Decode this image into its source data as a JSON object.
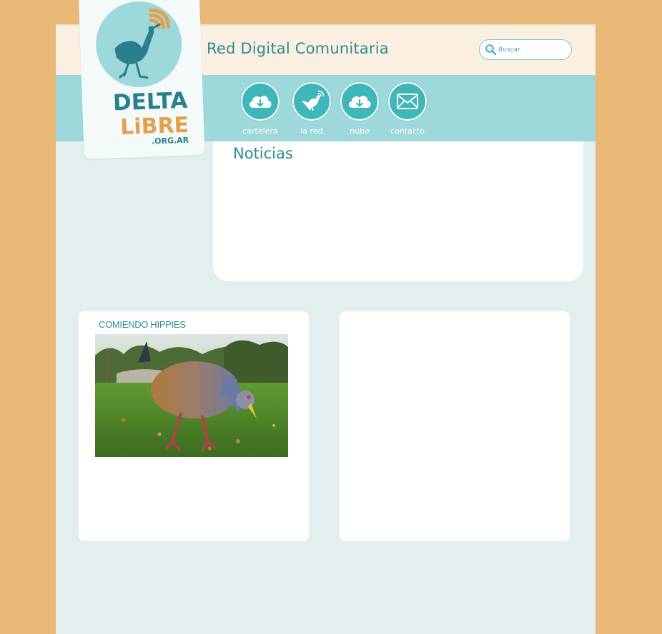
{
  "header": {
    "site_title": "Red Digital Comunitaria",
    "search_placeholder": "Buscar"
  },
  "logo": {
    "line1": "DELTA",
    "line2": "LiBRE",
    "line3": ".ORG.AR"
  },
  "nav": {
    "items": [
      {
        "label": "cartelera",
        "icon": "cloud-download-icon"
      },
      {
        "label": "la red",
        "icon": "bird-wifi-icon"
      },
      {
        "label": "nube",
        "icon": "cloud-download-icon"
      },
      {
        "label": "contacto",
        "icon": "envelope-icon"
      }
    ]
  },
  "news": {
    "title": "Noticias"
  },
  "cards": {
    "left_title": "COMIENDO HIPPIES",
    "left_image": "bird-eating-photo"
  },
  "colors": {
    "background": "#e8b877",
    "accent": "#2e8c94",
    "navbar": "#9dd9da",
    "nav_circle": "#3fb6b9",
    "logo_orange": "#e4a04b"
  }
}
